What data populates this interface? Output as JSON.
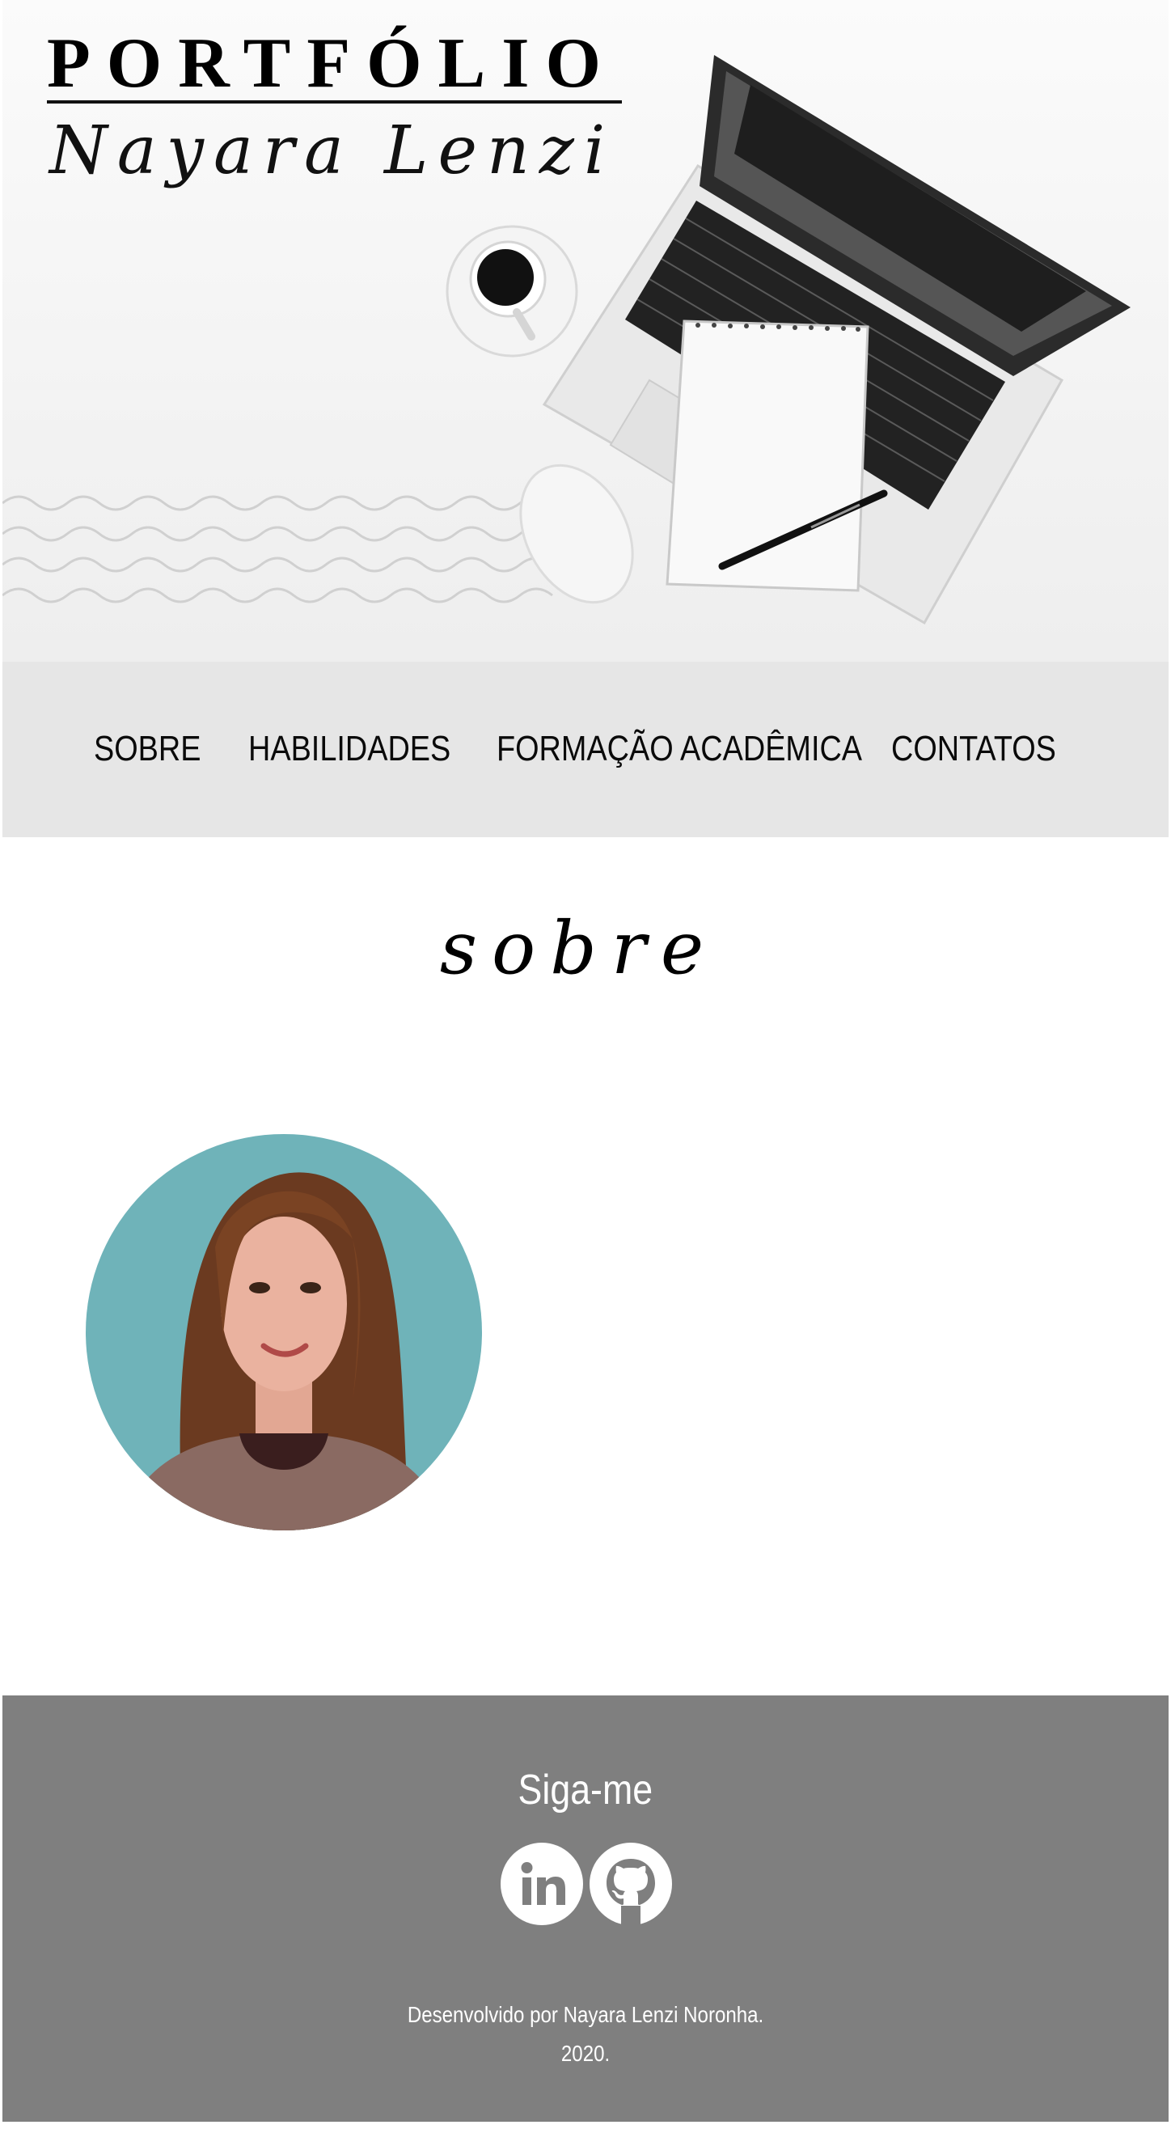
{
  "hero": {
    "title": "PORTFÓLIO",
    "subtitle": "Nayara Lenzi",
    "illustration_icon": "laptop-coffee-notebook-illustration"
  },
  "nav": {
    "items": [
      {
        "label": "SOBRE"
      },
      {
        "label": "HABILIDADES"
      },
      {
        "label": "FORMAÇÃO ACADÊMICA"
      },
      {
        "label": "CONTATOS"
      }
    ]
  },
  "about": {
    "heading": "sobre",
    "avatar_icon": "profile-photo"
  },
  "footer": {
    "follow_title": "Siga-me",
    "social": [
      {
        "icon": "linkedin-icon"
      },
      {
        "icon": "github-icon"
      }
    ],
    "credits_line1": "Desenvolvido por Nayara Lenzi Noronha.",
    "credits_line2": "2020."
  },
  "colors": {
    "nav_background": "#e6e6e6",
    "footer_background": "#7f7f7f",
    "footer_text": "#ffffff",
    "avatar_background": "#6fb3b9"
  }
}
